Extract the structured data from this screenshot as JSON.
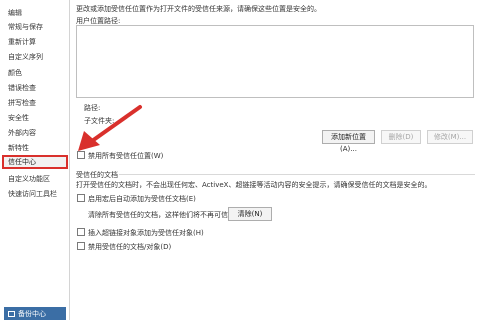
{
  "sidebar": {
    "items": [
      {
        "label": "编辑"
      },
      {
        "label": "常规与保存"
      },
      {
        "label": "重新计算"
      },
      {
        "label": "自定义序列"
      },
      {
        "label": "颜色"
      },
      {
        "label": "错误检查"
      },
      {
        "label": "拼写检查"
      },
      {
        "label": "安全性"
      },
      {
        "label": "外部内容"
      },
      {
        "label": "新特性"
      },
      {
        "label": "信任中心"
      },
      {
        "label": "自定义功能区"
      },
      {
        "label": "快速访问工具栏"
      }
    ],
    "footer_label": "备份中心"
  },
  "trusted_locations": {
    "description": "更改或添加受信任位置作为打开文件的受信任来源，请确保这些位置是安全的。",
    "list_header": "用户位置路径:",
    "path_label": "路径:",
    "subfolder_label": "子文件夹:",
    "add_button": "添加新位置(A)...",
    "delete_button": "删除(D)",
    "modify_button": "修改(M)...",
    "disable_all_label": "禁用所有受信任位置(W)"
  },
  "trusted_documents": {
    "section_title": "受信任的文档",
    "description": "打开受信任的文档时，不会出现任何宏、ActiveX、超链接等活动内容的安全提示，请确保受信任的文档是安全的。",
    "auto_add_label": "启用宏后自动添加为受信任文档(E)",
    "clear_text": "清除所有受信任的文档，这样他们将不再可信",
    "clear_button": "清除(N)",
    "hyperlink_label": "插入超链接对象添加为受信任对象(H)",
    "disable_label": "禁用受信任的文档/对象(D)"
  },
  "colors": {
    "accent_red": "#d9302c",
    "footer_blue": "#3b6ea5"
  }
}
